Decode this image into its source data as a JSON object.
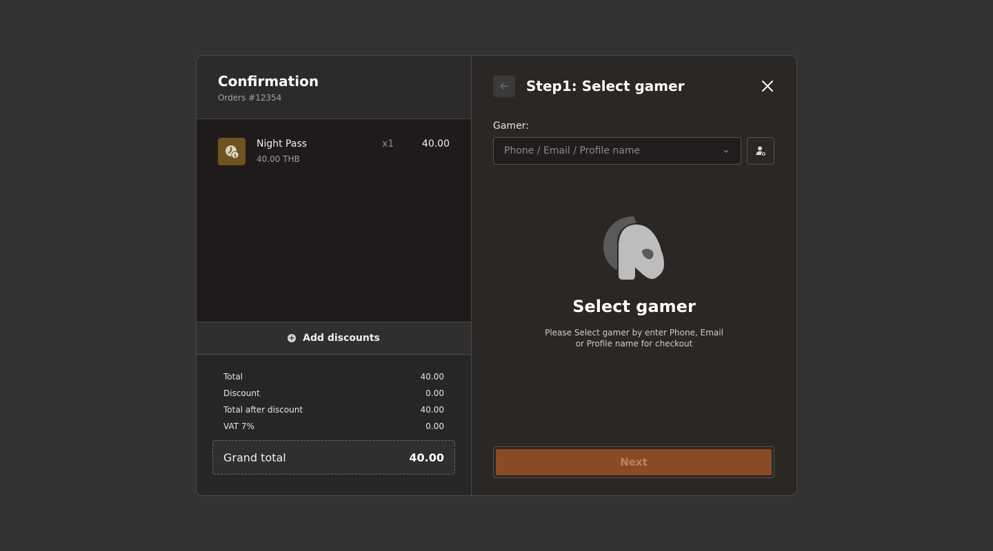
{
  "colors": {
    "background": "#333333",
    "panel": "#2a2725",
    "accent": "#8a4a25",
    "item_icon_bg": "#6e5320"
  },
  "confirmation": {
    "title": "Confirmation",
    "order_label": "Orders #12354"
  },
  "order_items": [
    {
      "name": "Night Pass",
      "unit_price": "40.00 THB",
      "qty": "x1",
      "price": "40.00",
      "icon": "clock-coin-icon"
    }
  ],
  "discounts": {
    "label": "Add discounts",
    "icon": "plus-circle-icon"
  },
  "summary": {
    "rows": [
      {
        "label": "Total",
        "value": "40.00"
      },
      {
        "label": "Discount",
        "value": "0.00"
      },
      {
        "label": "Total after discount",
        "value": "40.00"
      },
      {
        "label": "VAT 7%",
        "value": "0.00"
      }
    ],
    "grand_total_label": "Grand total",
    "grand_total_value": "40.00"
  },
  "step": {
    "title": "Step1: Select gamer",
    "back_icon": "arrow-left-icon",
    "close_icon": "close-icon"
  },
  "gamer": {
    "label": "Gamer:",
    "placeholder": "Phone / Email / Profile name",
    "add_icon": "add-user-icon"
  },
  "empty_state": {
    "icon": "spartan-helmet-icon",
    "title": "Select gamer",
    "description": "Please Select gamer by enter Phone, Email or Profile name for checkout"
  },
  "actions": {
    "next_label": "Next"
  }
}
